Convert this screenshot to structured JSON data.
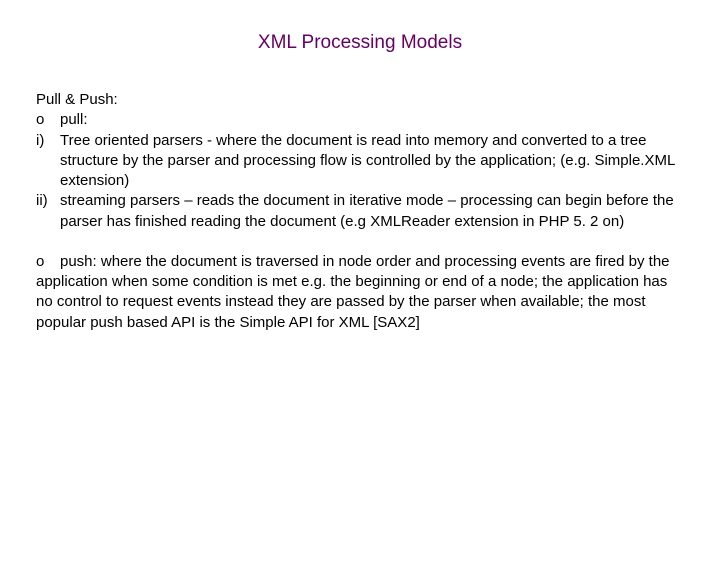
{
  "title": "XML Processing Models",
  "section_heading": "Pull & Push:",
  "pull_label_marker": "o",
  "pull_label": "pull:",
  "item1_marker": "i)",
  "item1_text": "Tree oriented parsers - where the document is read into memory and converted to a tree structure by the parser and processing flow is controlled by the application; (e.g. Simple.XML extension)",
  "item2_marker": "ii)",
  "item2_text": "streaming parsers – reads the document in iterative mode – processing can begin before the parser has finished reading the document (e.g XMLReader extension in PHP 5. 2 on)",
  "push_marker": "o",
  "push_text": "push: where the document is traversed in node order and processing events are fired by the application when some condition is met e.g. the beginning or end of a node; the application has no control to request events instead they are passed by the parser when available; the most popular push based API is the Simple API for XML [SAX2]"
}
